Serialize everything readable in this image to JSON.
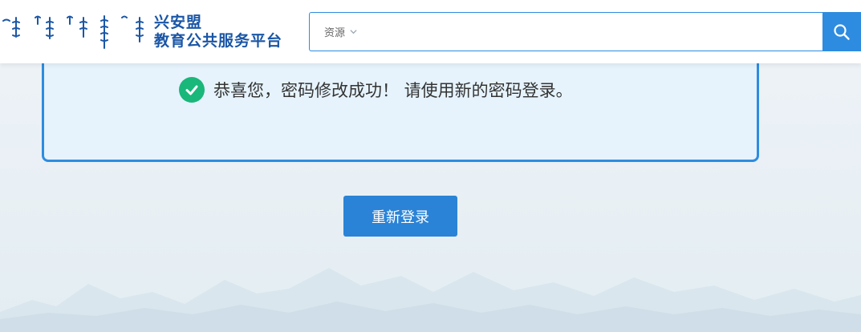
{
  "header": {
    "brand_title": "兴安盟",
    "brand_subtitle": "教育公共服务平台",
    "logo_script": "mongolian-script-logo"
  },
  "search": {
    "scope": "资源",
    "placeholder": "",
    "value": "",
    "button_icon": "search-icon"
  },
  "result": {
    "icon": "check-circle-icon",
    "message": "恭喜您，密码修改成功！ 请使用新的密码登录。"
  },
  "actions": {
    "relogin_label": "重新登录"
  },
  "colors": {
    "brand": "#1a56a6",
    "accent": "#2d8ce0",
    "success": "#19b77a",
    "panel_bg": "#e6f3fc"
  }
}
